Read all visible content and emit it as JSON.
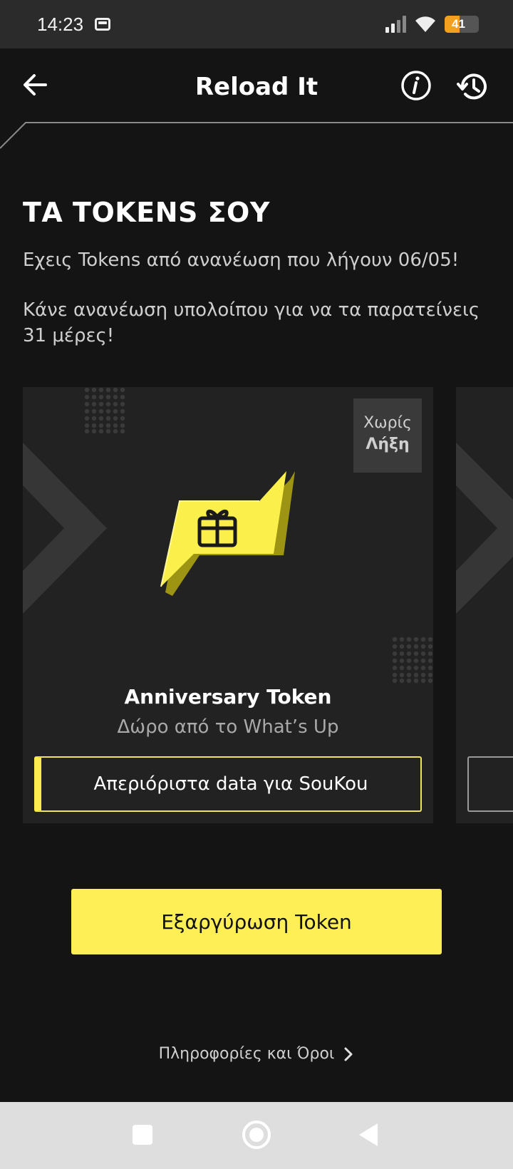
{
  "status_bar": {
    "time": "14:23",
    "battery_level": "41",
    "icons": [
      "sim-card-icon",
      "signal-icon",
      "wifi-icon",
      "battery-icon"
    ]
  },
  "header": {
    "title": "Reload It",
    "icons": [
      "back-arrow-icon",
      "info-icon",
      "history-icon"
    ]
  },
  "content": {
    "title": "ΤΑ TOKENS ΣΟΥ",
    "message1": "Εχεις Tokens από ανανέωση που λήγουν 06/05!",
    "message2": "Κάνε ανανέωση υπολοίπου για να τα παρατείνεις 31 μέρες!"
  },
  "token_card": {
    "badge_line1": "Χωρίς",
    "badge_line2": "Λήξη",
    "name": "Anniversary Token",
    "subtitle": "Δώρο από το What’s Up",
    "benefit": "Απεριόριστα data για SouKou",
    "icon": "gift-token-icon"
  },
  "actions": {
    "redeem_label": "Εξαργύρωση Token",
    "terms_label": "Πληροφορίες και Όροι"
  },
  "colors": {
    "background": "#141414",
    "card": "#222222",
    "accent_yellow": "#fdef55",
    "status_bar": "#2b2b2b",
    "nav_bar": "#dedede"
  }
}
